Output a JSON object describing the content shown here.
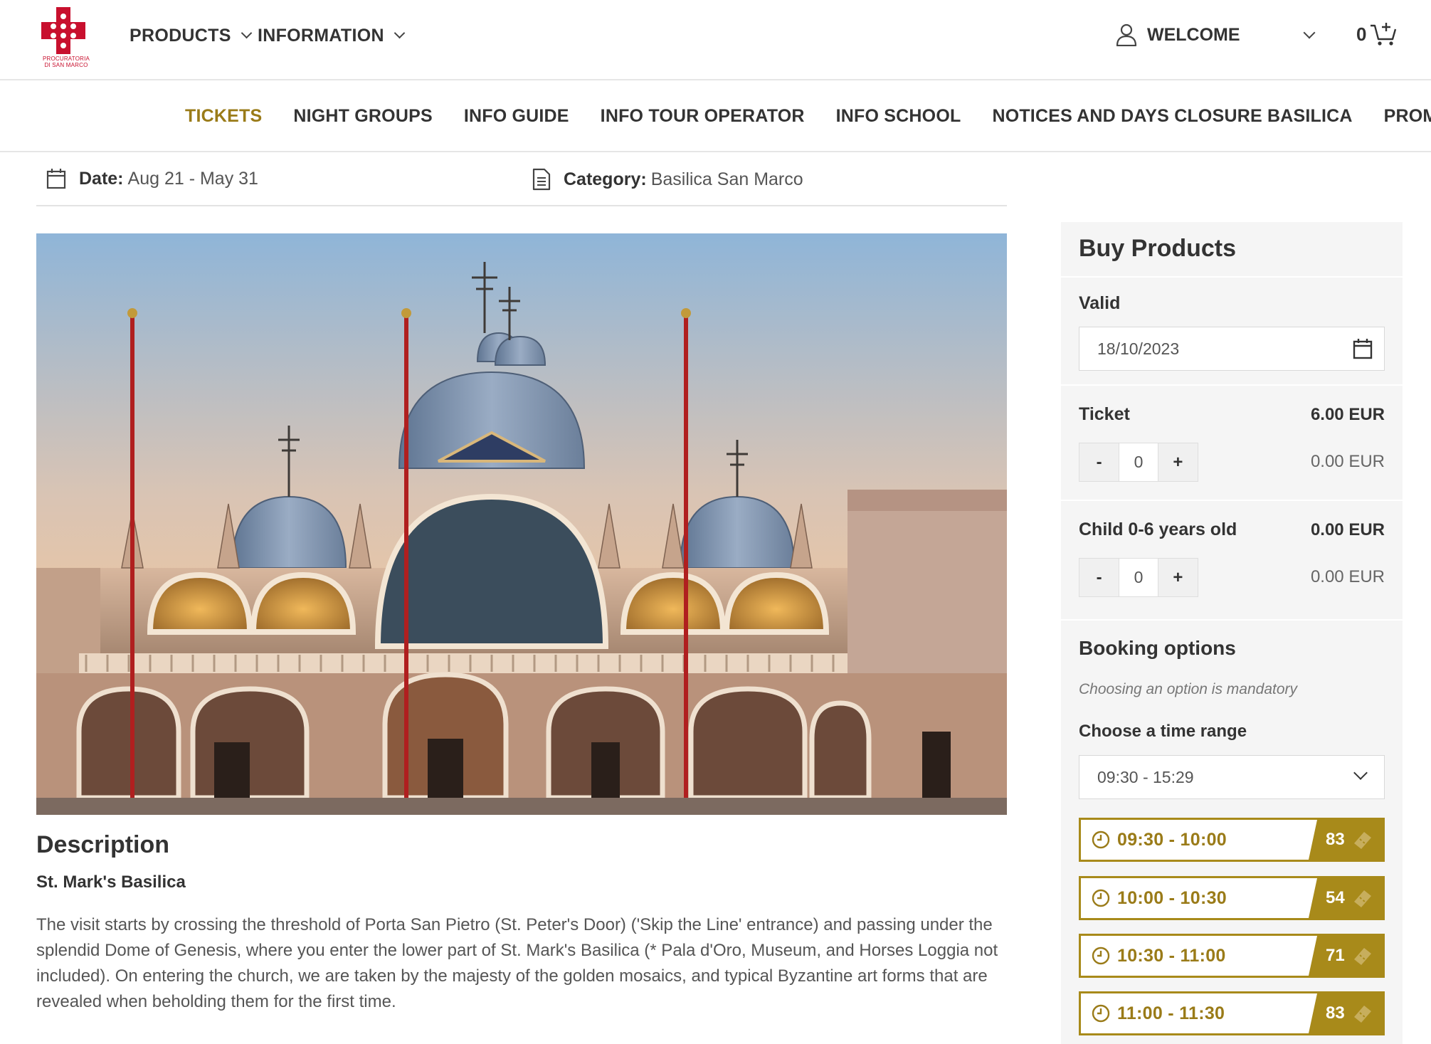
{
  "header": {
    "logo_text": "PROCURATORIA DI SAN MARCO",
    "nav": [
      {
        "label": "PRODUCTS"
      },
      {
        "label": "INFORMATION"
      }
    ],
    "welcome_label": "WELCOME",
    "cart_count": "0"
  },
  "subnav": {
    "items": [
      {
        "label": "TICKETS",
        "active": true
      },
      {
        "label": "NIGHT GROUPS"
      },
      {
        "label": "INFO GUIDE"
      },
      {
        "label": "INFO TOUR OPERATOR"
      },
      {
        "label": "INFO SCHOOL"
      },
      {
        "label": "NOTICES AND DAYS CLOSURE BASILICA"
      },
      {
        "label": "PROMO"
      }
    ]
  },
  "info": {
    "date_label": "Date:",
    "date_value": "Aug 21 - May 31",
    "category_label": "Category:",
    "category_value": "Basilica San Marco"
  },
  "description": {
    "title": "Description",
    "subtitle": "St. Mark's Basilica",
    "body": "The visit starts by crossing the threshold of Porta San Pietro (St. Peter's Door) ('Skip the Line' entrance) and passing under the splendid Dome of Genesis, where you enter the lower part of St. Mark's Basilica (* Pala d'Oro, Museum, and Horses Loggia not included). On entering the church, we are taken by the majesty of the golden mosaics, and typical Byzantine art forms that are revealed when beholding them for the first time."
  },
  "panel": {
    "title": "Buy Products",
    "valid_label": "Valid",
    "valid_date": "18/10/2023",
    "ticket": {
      "label": "Ticket",
      "price": "6.00 EUR",
      "qty": "0",
      "subtotal": "0.00 EUR",
      "minus": "-",
      "plus": "+"
    },
    "child": {
      "label": "Child 0-6 years old",
      "price": "0.00 EUR",
      "qty": "0",
      "subtotal": "0.00 EUR",
      "minus": "-",
      "plus": "+"
    },
    "booking_title": "Booking options",
    "booking_hint": "Choosing an option is mandatory",
    "time_range_label": "Choose a time range",
    "time_range_selected": "09:30 - 15:29",
    "slots": [
      {
        "time": "09:30 - 10:00",
        "available": "83"
      },
      {
        "time": "10:00 - 10:30",
        "available": "54"
      },
      {
        "time": "10:30 - 11:00",
        "available": "71"
      },
      {
        "time": "11:00 - 11:30",
        "available": "83"
      }
    ]
  },
  "colors": {
    "accent_gold": "#a88a1a",
    "active_nav": "#9a7b18",
    "logo_red": "#c8102e",
    "panel_bg": "#f5f5f5"
  }
}
